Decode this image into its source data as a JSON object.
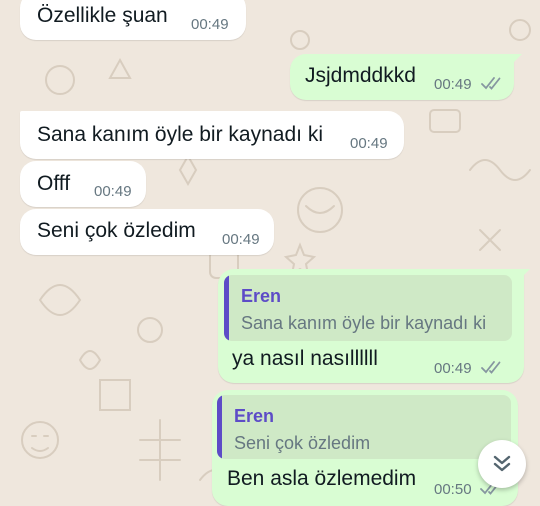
{
  "messages": [
    {
      "text": "Özellikle şuan",
      "time": "00:49"
    },
    {
      "text": "Jsjdmddkkd",
      "time": "00:49"
    },
    {
      "text": "Sana kanım öyle bir kaynadı ki",
      "time": "00:49"
    },
    {
      "text": "Offf",
      "time": "00:49"
    },
    {
      "text": "Seni çok özledim",
      "time": "00:49"
    },
    {
      "text": "ya nasıl nasıllllll",
      "time": "00:49",
      "quote_author": "Eren",
      "quote_text": "Sana kanım öyle bir kaynadı ki"
    },
    {
      "text": "Ben asla özlemedim",
      "time": "00:50",
      "quote_author": "Eren",
      "quote_text": "Seni çok özledim"
    }
  ],
  "colors": {
    "wallpaper": "#efe7dd",
    "incoming_bubble": "#ffffff",
    "outgoing_bubble": "#d9fdd3",
    "quote_accent": "#5d4cc7",
    "timestamp": "#667781"
  },
  "icons": {
    "read_receipt": "double-check-icon",
    "scroll_down": "double-chevron-down-icon"
  }
}
